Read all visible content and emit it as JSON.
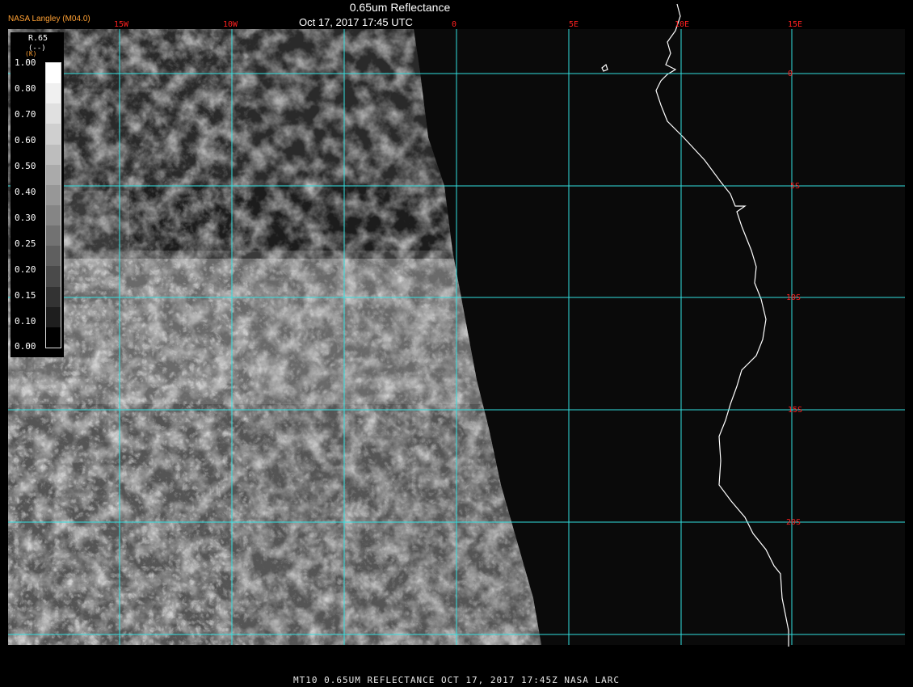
{
  "header": {
    "brand": "NASA Langley (M04.0)",
    "title": "0.65um Reflectance",
    "timestamp": "Oct 17, 2017 17:45 UTC"
  },
  "legend": {
    "title": "R.65",
    "unit": "(--)",
    "unit_k": "(K)",
    "ticks": [
      "1.00",
      "0.80",
      "0.70",
      "0.60",
      "0.50",
      "0.40",
      "0.30",
      "0.25",
      "0.20",
      "0.15",
      "0.10",
      "0.00"
    ],
    "steps": [
      "#ffffff",
      "#f0f0f0",
      "#e0e0e0",
      "#cfcfcf",
      "#bdbdbd",
      "#aaaaaa",
      "#979797",
      "#858585",
      "#727272",
      "#5f5f5f",
      "#4a4a4a",
      "#333333",
      "#1e1e1e",
      "#000000"
    ]
  },
  "map": {
    "grid_color": "#33e0e0",
    "coast_color": "#ffffff",
    "label_color": "#ff2020",
    "lon_labels": [
      "15W",
      "10W",
      "0",
      "5E",
      "10E",
      "15E"
    ],
    "lat_labels": [
      "0",
      "5S",
      "10S",
      "15S",
      "20S"
    ]
  },
  "footer": {
    "caption": "MT10  0.65UM REFLECTANCE   OCT 17, 2017 17:45Z   NASA LARC"
  }
}
